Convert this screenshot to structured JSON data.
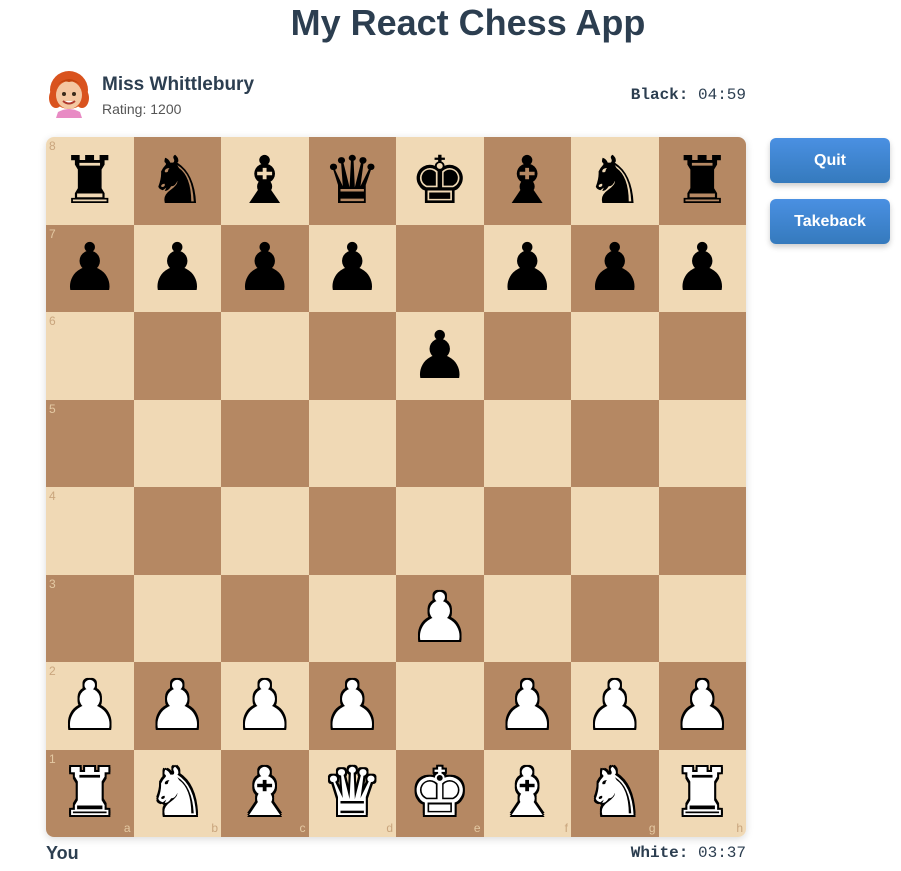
{
  "app": {
    "title": "My React Chess App"
  },
  "opponent": {
    "name": "Miss Whittlebury",
    "rating_label": "Rating: 1200",
    "avatar_icon": "woman-red-hair-avatar"
  },
  "clocks": {
    "black_label": "Black:",
    "black_time": "04:59",
    "white_label": "White:",
    "white_time": "03:37"
  },
  "player": {
    "name": "You"
  },
  "buttons": {
    "quit": "Quit",
    "takeback": "Takeback"
  },
  "board": {
    "light_color": "#f0d9b5",
    "dark_color": "#b58863",
    "ranks": [
      "8",
      "7",
      "6",
      "5",
      "4",
      "3",
      "2",
      "1"
    ],
    "files": [
      "a",
      "b",
      "c",
      "d",
      "e",
      "f",
      "g",
      "h"
    ],
    "position": [
      [
        "bR",
        "bN",
        "bB",
        "bQ",
        "bK",
        "bB",
        "bN",
        "bR"
      ],
      [
        "bP",
        "bP",
        "bP",
        "bP",
        "",
        "bP",
        "bP",
        "bP"
      ],
      [
        "",
        "",
        "",
        "",
        "bP",
        "",
        "",
        ""
      ],
      [
        "",
        "",
        "",
        "",
        "",
        "",
        "",
        ""
      ],
      [
        "",
        "",
        "",
        "",
        "",
        "",
        "",
        ""
      ],
      [
        "",
        "",
        "",
        "",
        "wP",
        "",
        "",
        ""
      ],
      [
        "wP",
        "wP",
        "wP",
        "wP",
        "",
        "wP",
        "wP",
        "wP"
      ],
      [
        "wR",
        "wN",
        "wB",
        "wQ",
        "wK",
        "wB",
        "wN",
        "wR"
      ]
    ]
  }
}
